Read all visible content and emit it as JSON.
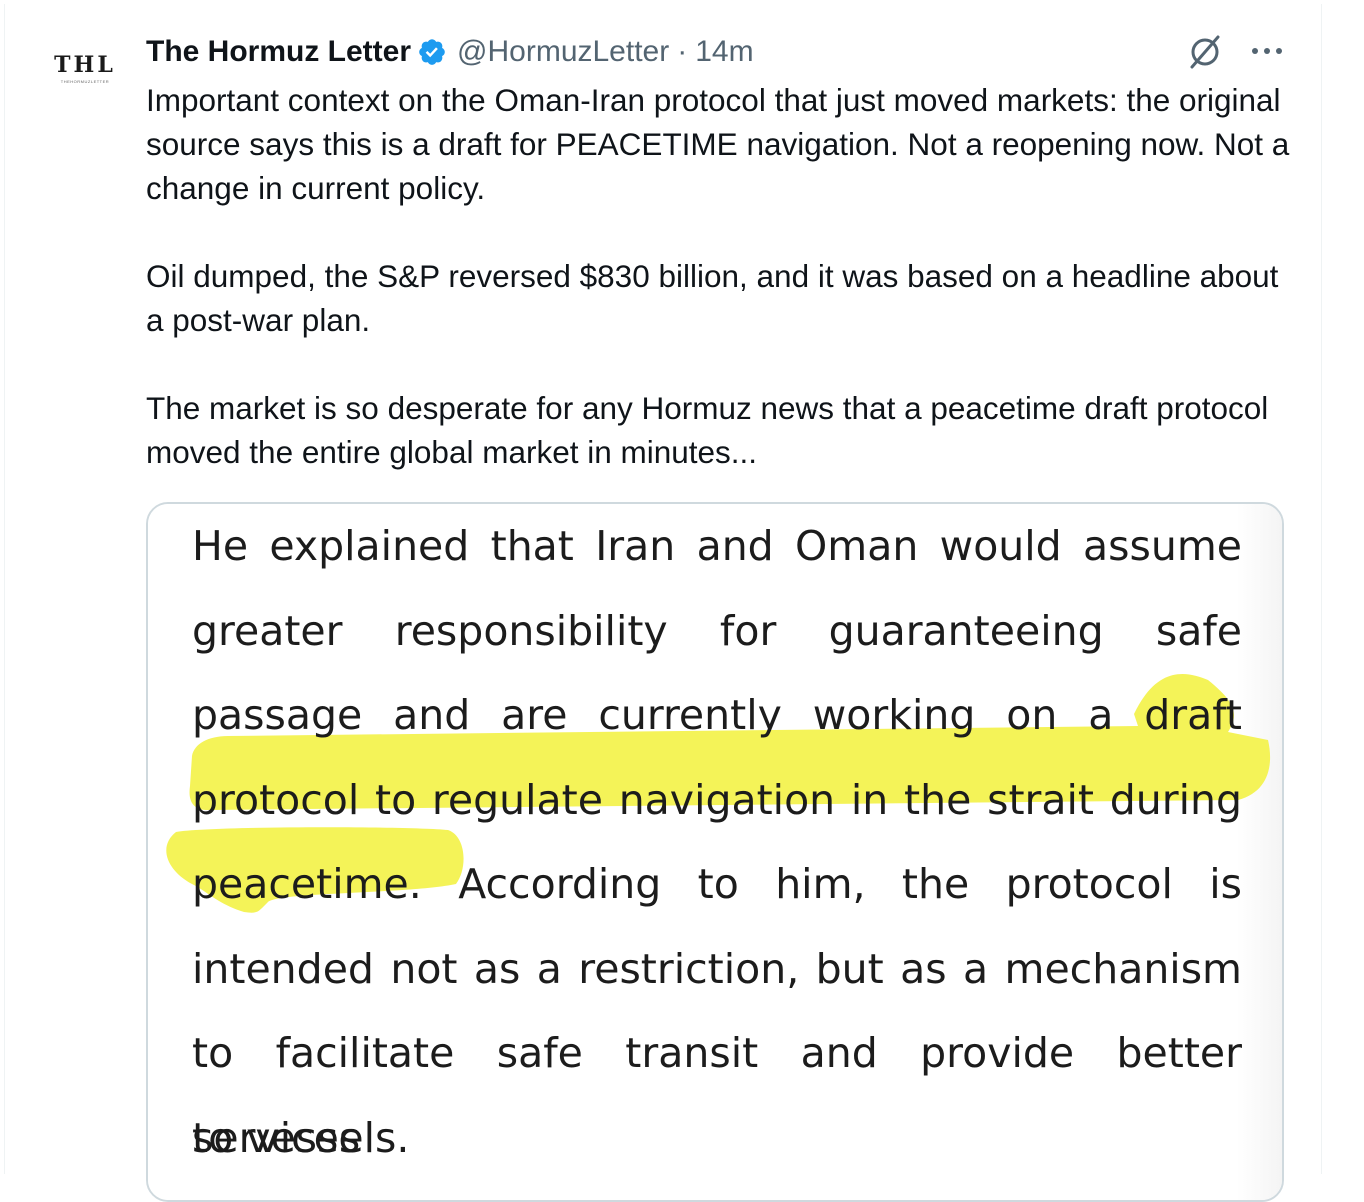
{
  "tweet": {
    "avatar": {
      "initials": "THL",
      "subtext": "THEHORMUZLETTER"
    },
    "author_name": "The Hormuz Letter",
    "handle": "@HormuzLetter",
    "separator": "·",
    "time": "14m",
    "paragraphs": [
      "Important context on the Oman-Iran protocol that just moved markets: the original source says this is a draft for PEACETIME navigation. Not a reopening now. Not a change in current policy.",
      "Oil dumped, the S&P reversed $830 billion, and it was based on a headline about a post-war plan.",
      "The market is so desperate for any Hormuz news that a peacetime draft protocol moved the entire global market in minutes..."
    ]
  },
  "media": {
    "lines": [
      "He explained that Iran and Oman would assume",
      "greater responsibility for guaranteeing safe",
      "passage and are currently working on a draft",
      "protocol to regulate navigation in the strait during",
      "peacetime. According to him, the protocol is",
      "intended not as a restriction, but as a mechanism",
      "to facilitate safe transit and provide better services",
      "to vessels."
    ],
    "highlight_color": "#f3f24a"
  },
  "icons": {
    "verified": "verified-badge-icon",
    "grok": "grok-icon",
    "more": "more-options-icon"
  },
  "colors": {
    "accent": "#1d9bf0",
    "secondary_text": "#536471",
    "border": "#cfd9de"
  }
}
